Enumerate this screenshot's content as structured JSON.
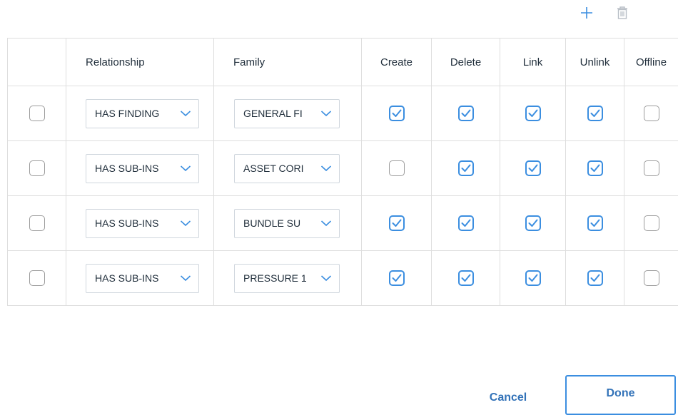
{
  "toolbar": {
    "add_icon": "plus-icon",
    "delete_icon": "trash-icon"
  },
  "columns": [
    "Relationship",
    "Family",
    "Create",
    "Delete",
    "Link",
    "Unlink",
    "Offline"
  ],
  "rows": [
    {
      "selected": false,
      "relationship": "HAS FINDING",
      "family": "GENERAL FI",
      "create": true,
      "delete": true,
      "link": true,
      "unlink": true,
      "offline": false
    },
    {
      "selected": false,
      "relationship": "HAS SUB-INS",
      "family": "ASSET CORI",
      "create": false,
      "delete": true,
      "link": true,
      "unlink": true,
      "offline": false
    },
    {
      "selected": false,
      "relationship": "HAS SUB-INS",
      "family": "BUNDLE SU",
      "create": true,
      "delete": true,
      "link": true,
      "unlink": true,
      "offline": false
    },
    {
      "selected": false,
      "relationship": "HAS SUB-INS",
      "family": "PRESSURE 1",
      "create": true,
      "delete": true,
      "link": true,
      "unlink": true,
      "offline": false
    }
  ],
  "footer": {
    "cancel_label": "Cancel",
    "done_label": "Done"
  },
  "colors": {
    "accent": "#3b8ee0",
    "link_text": "#3272b8",
    "border": "#dedede"
  }
}
